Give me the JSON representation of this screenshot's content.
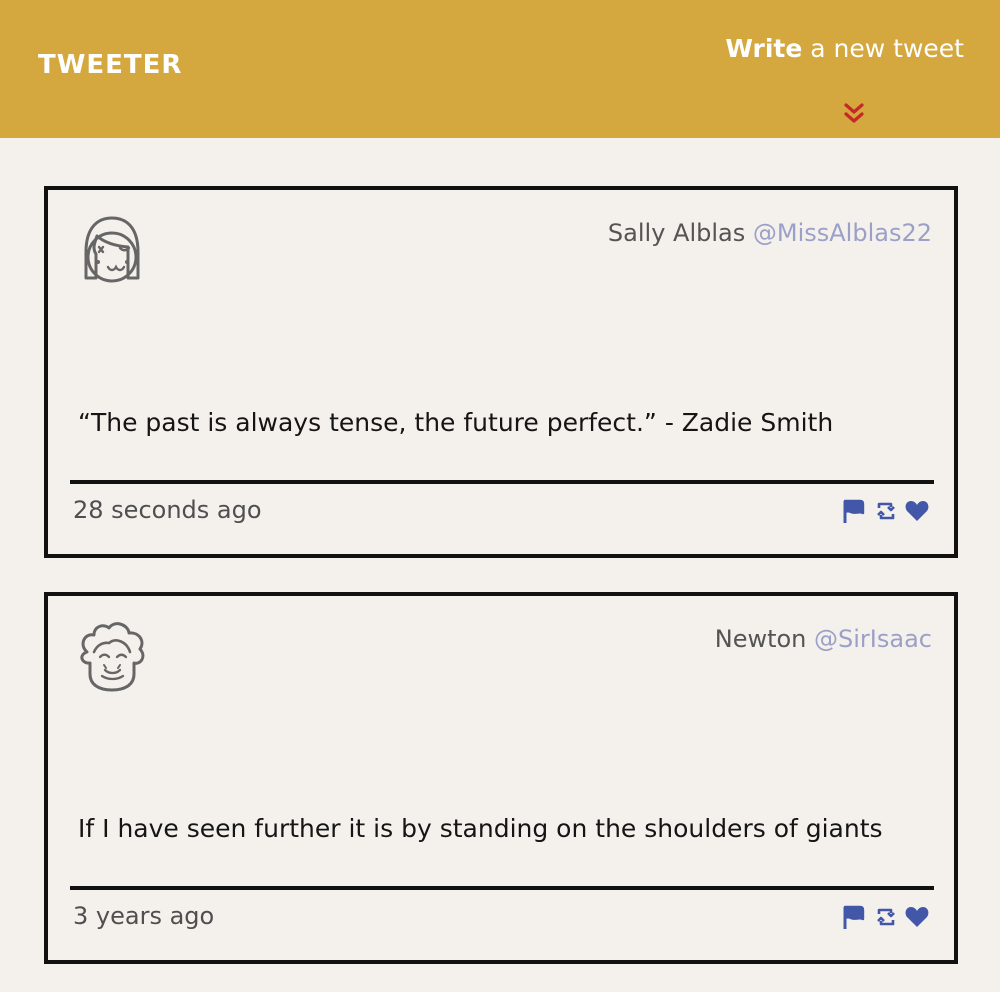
{
  "header": {
    "logo": "TWEETER",
    "compose": {
      "strong": "Write",
      "rest": " a new tweet"
    }
  },
  "tweets": [
    {
      "author": "Sally Alblas",
      "handle": "@MissAlblas22",
      "text": "“The past is always tense, the future perfect.”  - Zadie Smith",
      "time": "28 seconds ago",
      "avatar_icon": "girl-avatar-icon"
    },
    {
      "author": "Newton",
      "handle": "@SirIsaac",
      "text": "If I have seen further it is by standing on the shoulders of giants",
      "time": "3 years ago",
      "avatar_icon": "curly-hair-avatar-icon"
    }
  ],
  "colors": {
    "header": "#d4a73f",
    "page": "#f4f1ec",
    "accent": "#4257a8",
    "handle": "#9ba0c8",
    "chevron": "#c62828"
  },
  "icons": {
    "compose_toggle": "double-chevron-down-icon",
    "flag": "flag-icon",
    "retweet": "retweet-icon",
    "like": "heart-icon"
  }
}
